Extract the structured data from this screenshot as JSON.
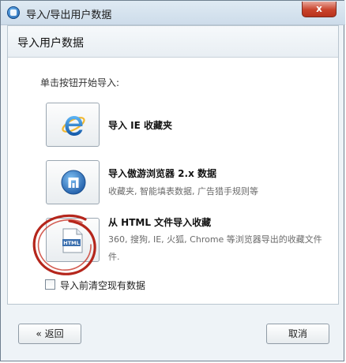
{
  "window": {
    "title": "导入/导出用户数据",
    "close_label": "x"
  },
  "panel": {
    "title": "导入用户数据",
    "instruction": "单击按钮开始导入:"
  },
  "options": [
    {
      "title": "导入 IE 收藏夹",
      "desc": "",
      "icon": "internet-explorer-icon"
    },
    {
      "title": "导入傲游浏览器 2.x 数据",
      "desc": "收藏夹, 智能填表数据, 广告猎手规则等",
      "icon": "maxthon-browser-icon"
    },
    {
      "title": "从 HTML 文件导入收藏",
      "desc_line1": "360, 搜狗, IE, 火狐, Chrome 等浏览器导出的收藏文件",
      "desc_line2": "件.",
      "icon_label": "HTML",
      "icon": "html-file-icon"
    }
  ],
  "checkbox": {
    "label": "导入前清空现有数据",
    "checked": false
  },
  "footer": {
    "back_label": "« 返回",
    "cancel_label": "取消"
  },
  "colors": {
    "annotation_circle": "#b5261c",
    "ie_blue": "#1f6fc3",
    "maxthon_blue": "#2f6fb8"
  }
}
